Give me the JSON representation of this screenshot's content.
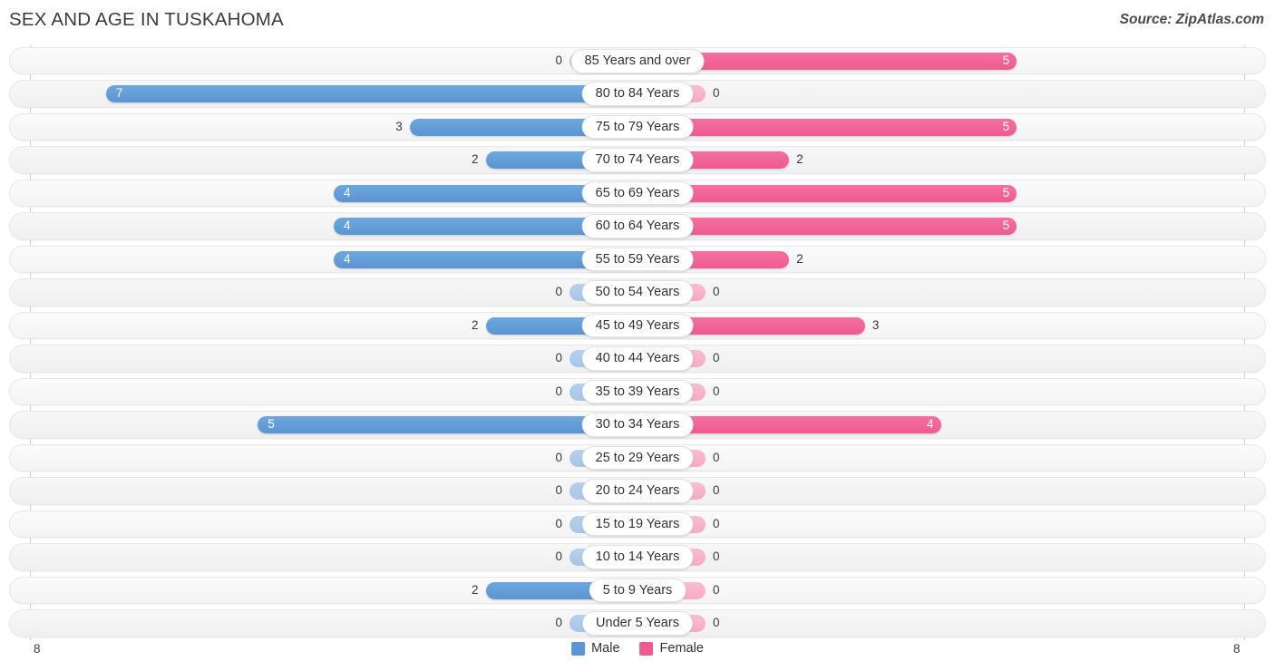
{
  "header": {
    "title": "SEX AND AGE IN TUSKAHOMA",
    "source": "Source: ZipAtlas.com"
  },
  "legend": {
    "male_label": "Male",
    "female_label": "Female",
    "male_color": "#5b95d2",
    "female_color": "#ef5a91"
  },
  "axis": {
    "left_tick": "8",
    "right_tick": "8",
    "max": 8
  },
  "chart_data": {
    "type": "bar",
    "subtype": "population-pyramid",
    "title": "SEX AND AGE IN TUSKAHOMA",
    "xlabel": "",
    "ylabel": "",
    "xlim": [
      8,
      8
    ],
    "grid": false,
    "legend_position": "bottom-center",
    "categories": [
      "85 Years and over",
      "80 to 84 Years",
      "75 to 79 Years",
      "70 to 74 Years",
      "65 to 69 Years",
      "60 to 64 Years",
      "55 to 59 Years",
      "50 to 54 Years",
      "45 to 49 Years",
      "40 to 44 Years",
      "35 to 39 Years",
      "30 to 34 Years",
      "25 to 29 Years",
      "20 to 24 Years",
      "15 to 19 Years",
      "10 to 14 Years",
      "5 to 9 Years",
      "Under 5 Years"
    ],
    "series": [
      {
        "name": "Male",
        "color": "#5b95d2",
        "values": [
          0,
          7,
          3,
          2,
          4,
          4,
          4,
          0,
          2,
          0,
          0,
          5,
          0,
          0,
          0,
          0,
          2,
          0
        ]
      },
      {
        "name": "Female",
        "color": "#ef5a91",
        "values": [
          5,
          0,
          5,
          2,
          5,
          5,
          2,
          0,
          3,
          0,
          0,
          4,
          0,
          0,
          0,
          0,
          0,
          0
        ]
      }
    ]
  },
  "rows": [
    {
      "label": "85 Years and over",
      "male": "0",
      "female": "5"
    },
    {
      "label": "80 to 84 Years",
      "male": "7",
      "female": "0"
    },
    {
      "label": "75 to 79 Years",
      "male": "3",
      "female": "5"
    },
    {
      "label": "70 to 74 Years",
      "male": "2",
      "female": "2"
    },
    {
      "label": "65 to 69 Years",
      "male": "4",
      "female": "5"
    },
    {
      "label": "60 to 64 Years",
      "male": "4",
      "female": "5"
    },
    {
      "label": "55 to 59 Years",
      "male": "4",
      "female": "2"
    },
    {
      "label": "50 to 54 Years",
      "male": "0",
      "female": "0"
    },
    {
      "label": "45 to 49 Years",
      "male": "2",
      "female": "3"
    },
    {
      "label": "40 to 44 Years",
      "male": "0",
      "female": "0"
    },
    {
      "label": "35 to 39 Years",
      "male": "0",
      "female": "0"
    },
    {
      "label": "30 to 34 Years",
      "male": "5",
      "female": "4"
    },
    {
      "label": "25 to 29 Years",
      "male": "0",
      "female": "0"
    },
    {
      "label": "20 to 24 Years",
      "male": "0",
      "female": "0"
    },
    {
      "label": "15 to 19 Years",
      "male": "0",
      "female": "0"
    },
    {
      "label": "10 to 14 Years",
      "male": "0",
      "female": "0"
    },
    {
      "label": "5 to 9 Years",
      "male": "2",
      "female": "0"
    },
    {
      "label": "Under 5 Years",
      "male": "0",
      "female": "0"
    }
  ]
}
